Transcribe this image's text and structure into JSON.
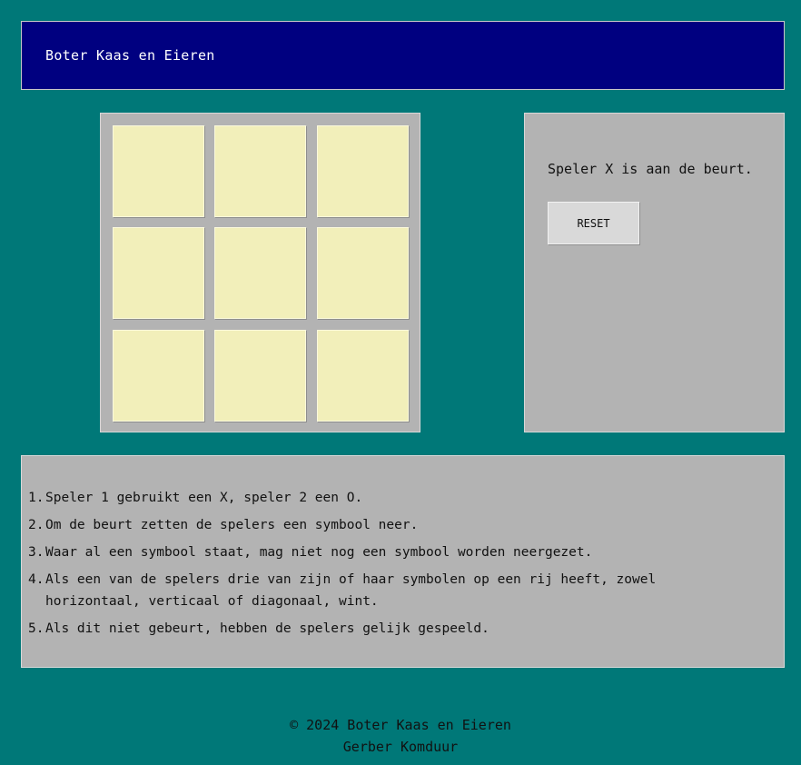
{
  "header": {
    "title": "Boter Kaas en Eieren"
  },
  "board": {
    "cells": [
      "",
      "",
      "",
      "",
      "",
      "",
      "",
      "",
      ""
    ]
  },
  "panel": {
    "status": "Speler X is aan de beurt.",
    "reset_label": "RESET"
  },
  "rules": {
    "items": [
      {
        "num": "1.",
        "text": "Speler 1 gebruikt een X, speler 2 een O."
      },
      {
        "num": "2.",
        "text": "Om de beurt zetten de spelers een symbool neer."
      },
      {
        "num": "3.",
        "text": "Waar al een symbool staat, mag niet nog een symbool worden neergezet."
      },
      {
        "num": "4.",
        "text": "Als een van de spelers drie van zijn of haar symbolen op een rij heeft, zowel horizontaal, verticaal of diagonaal, wint."
      },
      {
        "num": "5.",
        "text": "Als dit niet gebeurt, hebben de spelers gelijk gespeeld."
      }
    ]
  },
  "footer": {
    "copyright": "© 2024 Boter Kaas en Eieren",
    "author": "Gerber Komduur"
  }
}
